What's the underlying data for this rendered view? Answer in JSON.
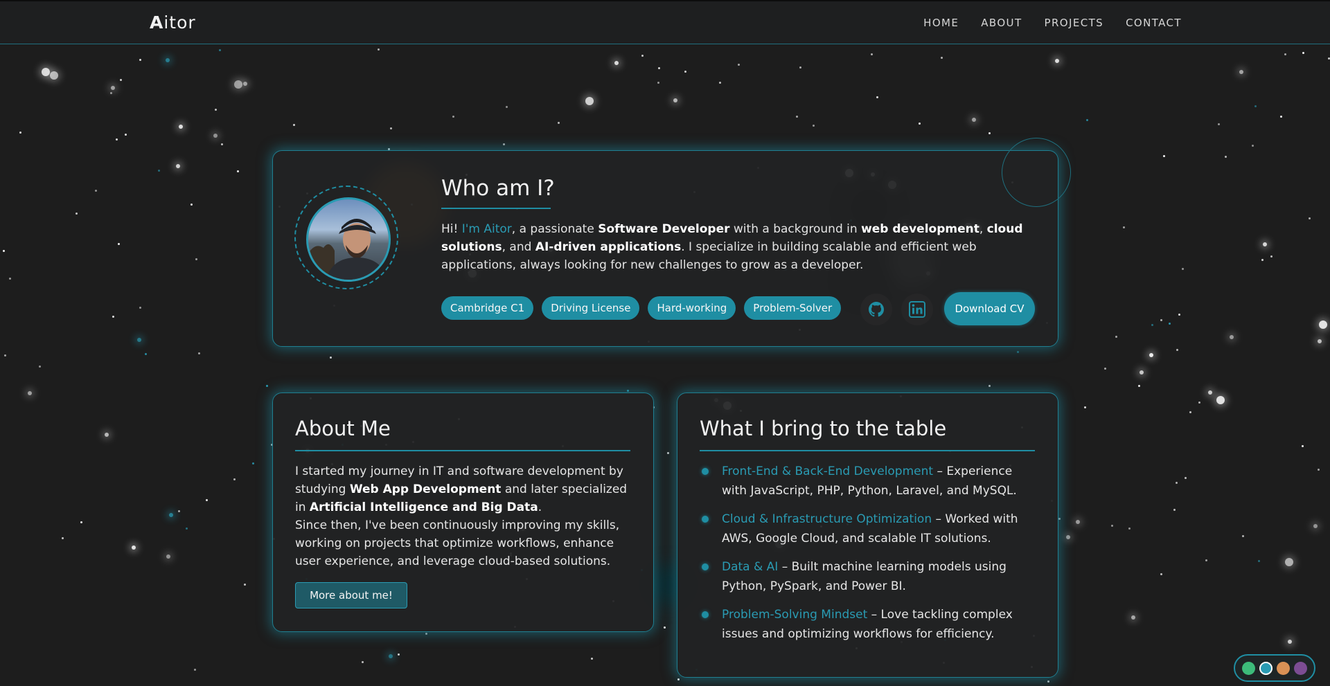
{
  "brand": {
    "initial": "A",
    "rest": "itor"
  },
  "nav": {
    "links": [
      "HOME",
      "ABOUT",
      "PROJECTS",
      "CONTACT"
    ]
  },
  "hero": {
    "title": "Who am I?",
    "intro": {
      "p1": "Hi! ",
      "name": "I'm Aitor",
      "p2": ", a passionate ",
      "b1": "Software Developer",
      "p3": " with a background in ",
      "b2": "web development",
      "p4": ", ",
      "b3": "cloud solutions",
      "p5": ", and ",
      "b4": "AI-driven applications",
      "p6": ". I specialize in building scalable and efficient web applications, always looking for new challenges to grow as a developer."
    },
    "badges": [
      "Cambridge C1",
      "Driving License",
      "Hard-working",
      "Problem-Solver"
    ],
    "download_label": "Download CV"
  },
  "about": {
    "title": "About Me",
    "text": {
      "t1": "I started my journey in IT and software development by studying ",
      "b1": "Web App Development",
      "t2": " and later specialized in ",
      "b2": "Artificial Intelligence and Big Data",
      "t3": ".",
      "t4": "Since then, I've been continuously improving my skills, working on projects that optimize workflows, enhance user experience, and leverage cloud-based solutions."
    },
    "button_label": "More about me!"
  },
  "bring": {
    "title": "What I bring to the table",
    "items": [
      {
        "highlight": "Front-End & Back-End Development",
        "text": " – Experience with JavaScript, PHP, Python, Laravel, and MySQL."
      },
      {
        "highlight": "Cloud & Infrastructure Optimization",
        "text": " – Worked with AWS, Google Cloud, and scalable IT solutions."
      },
      {
        "highlight": "Data & AI",
        "text": " – Built machine learning models using Python, PySpark, and Power BI."
      },
      {
        "highlight": "Problem-Solving Mindset",
        "text": " – Love tackling complex issues and optimizing workflows for efficiency."
      }
    ]
  },
  "theme": {
    "accent": "#1f8ea3",
    "swatches": [
      "#3dbb7a",
      "#2a9bb3",
      "#d99155",
      "#7c4d93"
    ],
    "active_swatch": 1
  }
}
